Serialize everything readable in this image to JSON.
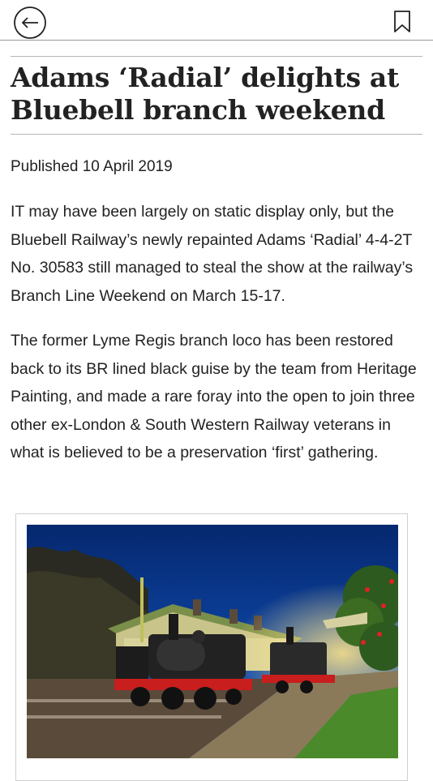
{
  "article": {
    "title": "Adams ‘Radial’ delights at Bluebell branch weekend",
    "published": "Published 10 April 2019",
    "paragraphs": [
      "IT may have been largely on static display only, but the Bluebell Railway’s newly repainted Adams ‘Radial’ 4-4-2T No. 30583 still managed to steal the show at the railway’s Branch Line Weekend on March 15-17.",
      "The former Lyme Regis branch loco has been restored back to its BR lined black guise by the team from Heritage Painting, and made a rare foray into the open to join three other ex-London & South Western Railway veterans in what is believed to be a preservation ‘first’ gathering."
    ]
  },
  "icons": {
    "back": "back-arrow-icon",
    "bookmark": "bookmark-icon"
  },
  "colors": {
    "text": "#222222",
    "rule": "#b5b5b5",
    "sky": "#0b3a8c"
  }
}
